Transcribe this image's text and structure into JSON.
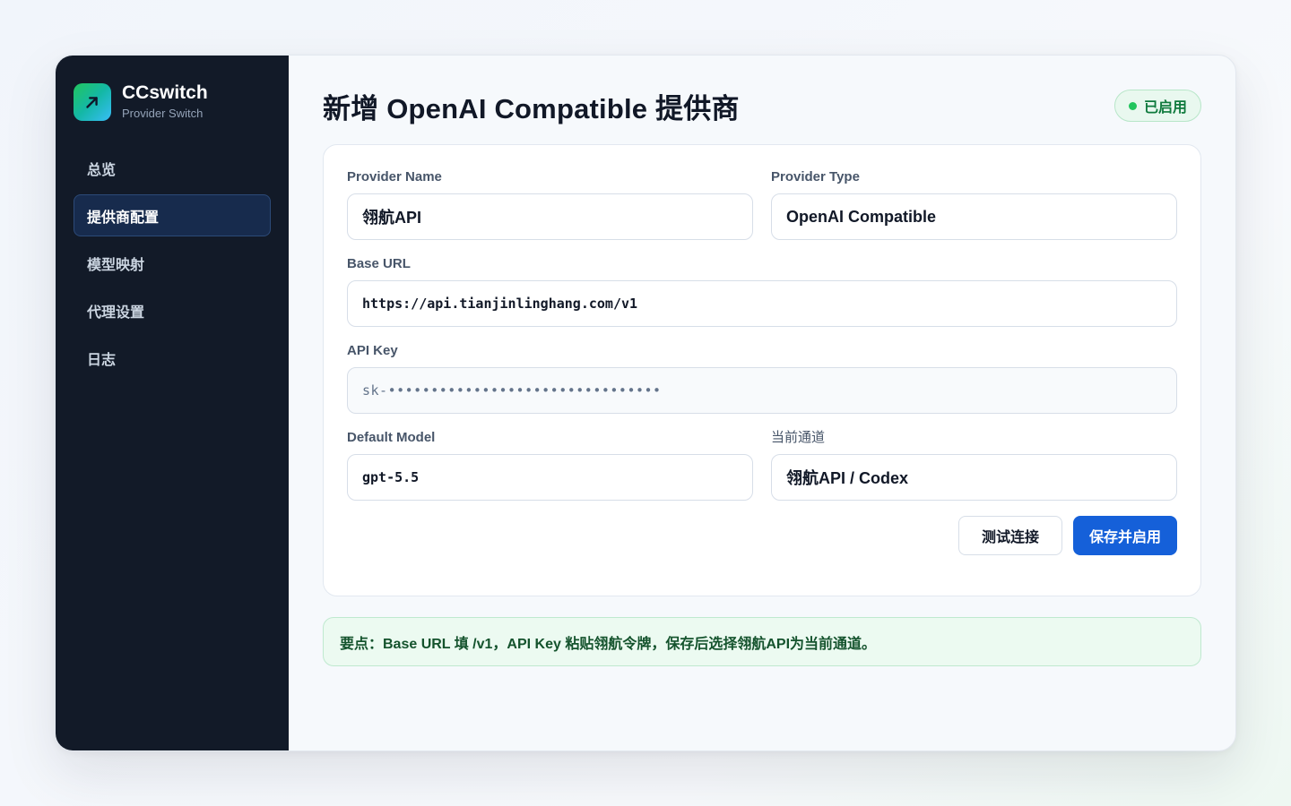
{
  "brand": {
    "name": "CCswitch",
    "subtitle": "Provider Switch",
    "logo_icon": "arrow-up-right-icon"
  },
  "sidebar": {
    "items": [
      {
        "label": "总览",
        "active": false
      },
      {
        "label": "提供商配置",
        "active": true
      },
      {
        "label": "模型映射",
        "active": false
      },
      {
        "label": "代理设置",
        "active": false
      },
      {
        "label": "日志",
        "active": false
      }
    ]
  },
  "header": {
    "title": "新增 OpenAI Compatible 提供商",
    "status_badge": "已启用"
  },
  "form": {
    "provider_name": {
      "label": "Provider Name",
      "value": "翎航API"
    },
    "provider_type": {
      "label": "Provider Type",
      "value": "OpenAI Compatible"
    },
    "base_url": {
      "label": "Base URL",
      "value": "https://api.tianjinlinghang.com/v1"
    },
    "api_key": {
      "label": "API Key",
      "value": "sk-••••••••••••••••••••••••••••••••"
    },
    "default_model": {
      "label": "Default Model",
      "value": "gpt-5.5"
    },
    "current_channel": {
      "label": "当前通道",
      "value": "翎航API / Codex"
    }
  },
  "actions": {
    "test_label": "测试连接",
    "save_label": "保存并启用"
  },
  "tip": "要点：Base URL 填 /v1，API Key 粘贴翎航令牌，保存后选择翎航API为当前通道。",
  "colors": {
    "sidebar_bg": "#121a28",
    "accent": "#1560d9",
    "success": "#22c55e"
  }
}
